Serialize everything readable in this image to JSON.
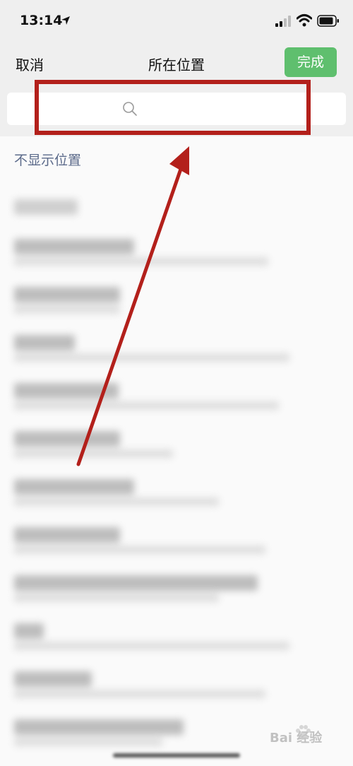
{
  "status_bar": {
    "time": "13:14"
  },
  "nav": {
    "cancel": "取消",
    "title": "所在位置",
    "done": "完成"
  },
  "search": {
    "placeholder": ""
  },
  "hide_location": "不显示位置",
  "list_items": [
    {
      "title": "",
      "sub": ""
    },
    {
      "title": "",
      "sub": ""
    },
    {
      "title": "",
      "sub": ""
    },
    {
      "title": "",
      "sub": ""
    },
    {
      "title": "",
      "sub": ""
    },
    {
      "title": "",
      "sub": ""
    },
    {
      "title": "",
      "sub": ""
    },
    {
      "title": "",
      "sub": ""
    },
    {
      "title": "",
      "sub": ""
    },
    {
      "title": "",
      "sub": ""
    },
    {
      "title": "",
      "sub": ""
    },
    {
      "title": "",
      "sub": ""
    }
  ],
  "watermark": "Bai 经验",
  "colors": {
    "accent_green": "#5fbf6e",
    "annotation_red": "#b3201b",
    "link_blue": "#5b6a8a"
  }
}
